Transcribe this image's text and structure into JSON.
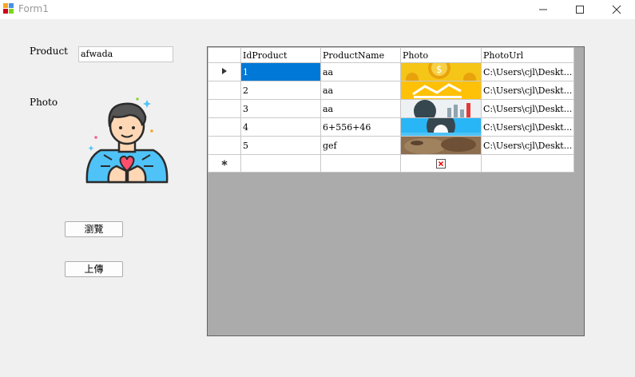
{
  "window": {
    "title": "Form1"
  },
  "form": {
    "product_label": "Product",
    "product_value": "afwada",
    "photo_label": "Photo",
    "browse_label": "瀏覽",
    "upload_label": "上傳"
  },
  "grid": {
    "headers": [
      "IdProduct",
      "ProductName",
      "Photo",
      "PhotoUrl"
    ],
    "rows": [
      {
        "id": "1",
        "name": "aa",
        "url": "C:\\Users\\cjl\\Deskt..."
      },
      {
        "id": "2",
        "name": "aa",
        "url": "C:\\Users\\cjl\\Deskt..."
      },
      {
        "id": "3",
        "name": "aa",
        "url": "C:\\Users\\cjl\\Deskt..."
      },
      {
        "id": "4",
        "name": "6+556+46",
        "url": "C:\\Users\\cjl\\Deskt..."
      },
      {
        "id": "5",
        "name": "gef",
        "url": "C:\\Users\\cjl\\Deskt..."
      }
    ],
    "selected_row": "1",
    "current_row_icon": "triangle-right-icon",
    "new_row_icon": "asterisk-icon",
    "broken_image_icon": "broken-image-icon"
  },
  "colors": {
    "selection": "#0078d7",
    "grid_background": "#ababab"
  }
}
